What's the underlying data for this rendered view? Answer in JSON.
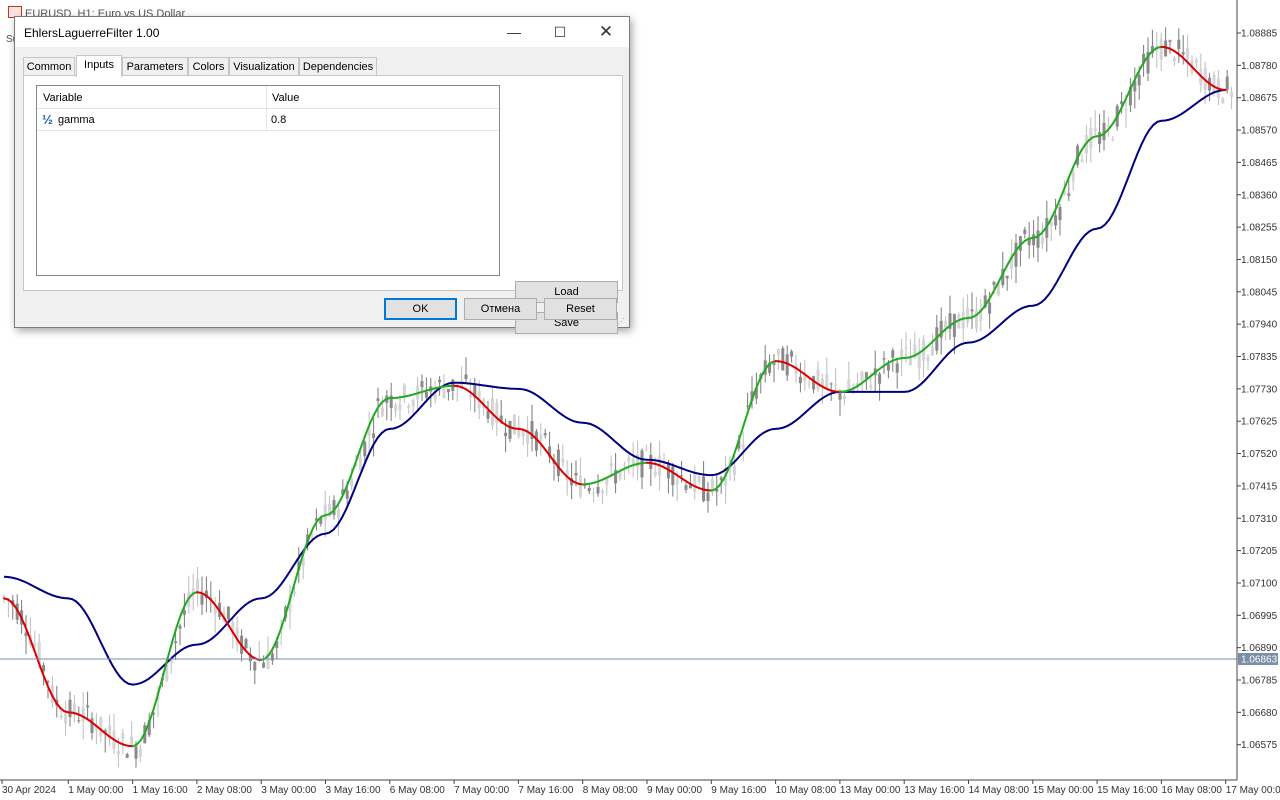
{
  "chart": {
    "title": "EURUSD, H1:  Euro vs US Dollar",
    "sub_label": "Sub",
    "price_labels": [
      "1.08885",
      "1.08780",
      "1.08675",
      "1.08570",
      "1.08465",
      "1.08360",
      "1.08255",
      "1.08150",
      "1.08045",
      "1.07940",
      "1.07835",
      "1.07730",
      "1.07625",
      "1.07520",
      "1.07415",
      "1.07310",
      "1.07205",
      "1.07100",
      "1.06995",
      "1.06890",
      "1.06785",
      "1.06680",
      "1.06575"
    ],
    "current_price": "1.06863",
    "time_labels": [
      "30 Apr 2024",
      "1 May 00:00",
      "1 May 16:00",
      "2 May 08:00",
      "3 May 00:00",
      "3 May 16:00",
      "6 May 08:00",
      "7 May 00:00",
      "7 May 16:00",
      "8 May 08:00",
      "9 May 00:00",
      "9 May 16:00",
      "10 May 08:00",
      "13 May 00:00",
      "13 May 16:00",
      "14 May 08:00",
      "15 May 00:00",
      "15 May 16:00",
      "16 May 08:00",
      "17 May 00:00"
    ],
    "colors": {
      "filter_up": "#22aa22",
      "filter_down": "#dd0000",
      "slow_line": "#000080",
      "candles": "#b0b0b0",
      "current_price_line": "#7a8ea8"
    }
  },
  "chart_data": {
    "type": "line",
    "title": "EURUSD, H1:  Euro vs US Dollar",
    "xlabel": "",
    "ylabel": "",
    "ylim": [
      1.065,
      1.0896
    ],
    "current_price": 1.06863,
    "x": [
      "30 Apr 2024",
      "1 May 00:00",
      "1 May 16:00",
      "2 May 08:00",
      "3 May 00:00",
      "3 May 16:00",
      "6 May 08:00",
      "7 May 00:00",
      "7 May 16:00",
      "8 May 08:00",
      "9 May 00:00",
      "9 May 16:00",
      "10 May 08:00",
      "13 May 00:00",
      "13 May 16:00",
      "14 May 08:00",
      "15 May 00:00",
      "15 May 16:00",
      "16 May 08:00",
      "17 May 00:00"
    ],
    "series": [
      {
        "values": [
          1.0705,
          1.0668,
          1.0657,
          1.0707,
          1.0685,
          1.0732,
          1.077,
          1.0774,
          1.076,
          1.0742,
          1.0749,
          1.074,
          1.0782,
          1.0772,
          1.0783,
          1.0796,
          1.0822,
          1.0855,
          1.0884,
          1.087
        ]
      },
      {
        "values": [
          1.0712,
          1.0705,
          1.0677,
          1.069,
          1.0705,
          1.0726,
          1.076,
          1.0775,
          1.0773,
          1.0762,
          1.075,
          1.0745,
          1.076,
          1.0772,
          1.0772,
          1.0788,
          1.08,
          1.0825,
          1.086,
          1.087
        ]
      }
    ]
  },
  "dialog": {
    "title": "EhlersLaguerreFilter 1.00",
    "window_buttons": {
      "minimize": "—",
      "maximize": "☐",
      "close": "✕"
    },
    "tabs": [
      "Common",
      "Inputs",
      "Parameters",
      "Colors",
      "Visualization",
      "Dependencies"
    ],
    "active_tab": "Inputs",
    "table": {
      "headers": [
        "Variable",
        "Value"
      ],
      "rows": [
        {
          "icon": "½",
          "icon_name": "fraction-icon",
          "name": "gamma",
          "value": "0.8"
        }
      ]
    },
    "buttons": {
      "load": "Load",
      "save": "Save",
      "ok": "OK",
      "cancel": "Отмена",
      "reset": "Reset"
    }
  }
}
